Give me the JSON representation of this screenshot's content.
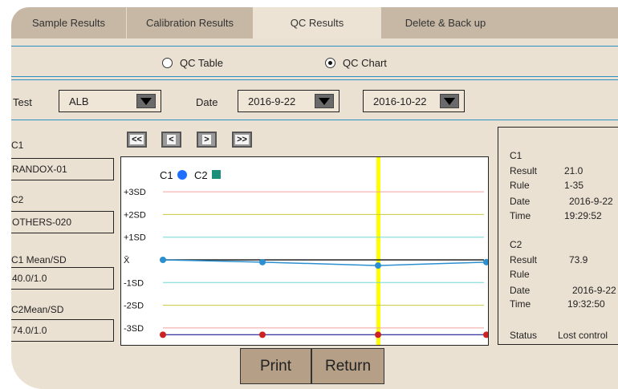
{
  "tabs": {
    "sample": "Sample Results",
    "calibration": "Calibration Results",
    "qc": "QC  Results",
    "delete": "Delete & Back up"
  },
  "view_mode": {
    "table_label": "QC Table",
    "chart_label": "QC Chart",
    "selected": "chart"
  },
  "filters": {
    "test_label": "Test",
    "test_value": "ALB",
    "date_label": "Date",
    "date_from": "2016-9-22",
    "date_to": "2016-10-22"
  },
  "left_panel": {
    "c1_label": "C1",
    "c1_value": "RANDOX-01",
    "c2_label": "C2",
    "c2_value": "OTHERS-020",
    "c1_meansd_label": "C1 Mean/SD",
    "c1_meansd_value": "40.0/1.0",
    "c2_meansd_label": "C2Mean/SD",
    "c2_meansd_value": "74.0/1.0"
  },
  "nav": {
    "first": "<<",
    "prev": "<",
    "next": ">",
    "last": ">>"
  },
  "chart_data": {
    "type": "line",
    "y_levels": [
      "+3SD",
      "+2SD",
      "+1SD",
      "X̄",
      "-1SD",
      "-2SD",
      "-3SD"
    ],
    "x": [
      1,
      2,
      3,
      4
    ],
    "series": [
      {
        "name": "C1",
        "color": "#1e6fff",
        "values": [
          0.0,
          -0.1,
          -0.25,
          -0.1
        ]
      },
      {
        "name": "C2",
        "color": "#1a8f7a",
        "values": [
          -3.3,
          -3.3,
          -3.3,
          -3.3
        ]
      }
    ],
    "ylim": [
      -3.3,
      3.3
    ],
    "selected_index": 3,
    "line_colors": {
      "sd3": "#f2a0a0",
      "sd2": "#c8c840",
      "sd1": "#70d8d8",
      "mean": "#222222",
      "cursor": "#ffff00",
      "c1_line": "#2b8fd0",
      "c2_marker": "#cc2222"
    },
    "grid": false
  },
  "right_panel": {
    "c1_header": "C1",
    "c1_result_label": "Result",
    "c1_result": "21.0",
    "c1_rule_label": "Rule",
    "c1_rule": "1-35",
    "c1_date_label": "Date",
    "c1_date": "2016-9-22",
    "c1_time_label": "Time",
    "c1_time": "19:29:52",
    "c2_header": "C2",
    "c2_result_label": "Result",
    "c2_result": "73.9",
    "c2_rule_label": "Rule",
    "c2_rule": "",
    "c2_date_label": "Date",
    "c2_date": "2016-9-22",
    "c2_time_label": "Time",
    "c2_time": "19:32:50",
    "status_label": "Status",
    "status_value": "Lost control"
  },
  "buttons": {
    "print": "Print",
    "return": "Return"
  }
}
